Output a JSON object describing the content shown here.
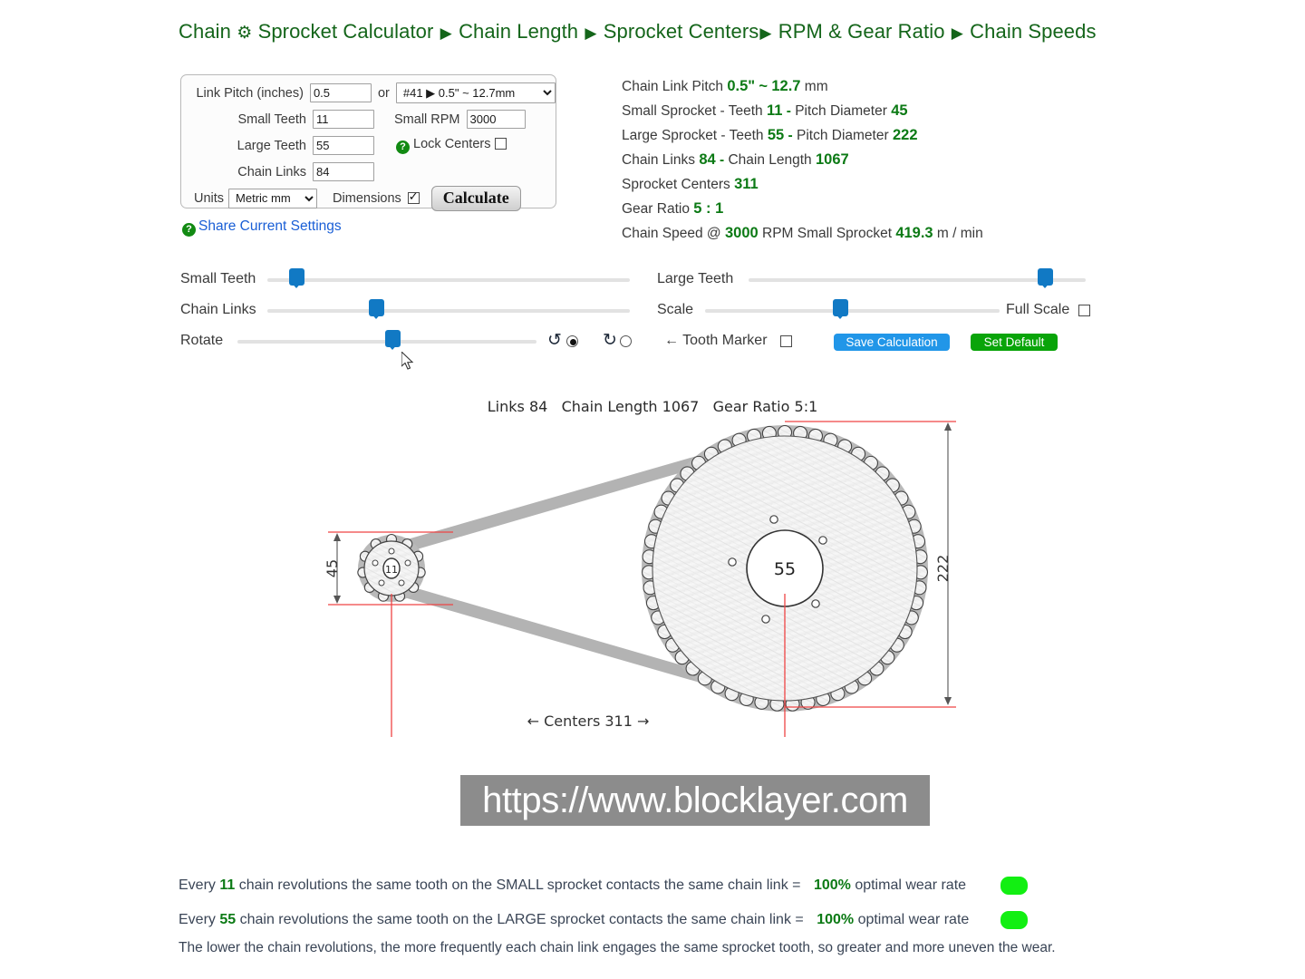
{
  "title": {
    "part1": "Chain",
    "gear_icon": "⚙",
    "part2": "Sprocket Calculator",
    "arrow": "▶",
    "link_chain_length": "Chain Length",
    "link_sprocket_centers": "Sprocket Centers",
    "link_rpm_gear_ratio": "RPM & Gear Ratio",
    "link_chain_speeds": "Chain Speeds"
  },
  "form": {
    "link_pitch_label": "Link Pitch (inches)",
    "link_pitch_value": "0.5",
    "or_label": "or",
    "chain_select_value": "#41 ▶ 0.5\" ~ 12.7mm",
    "small_teeth_label": "Small Teeth",
    "small_teeth_value": "11",
    "small_rpm_label": "Small RPM",
    "small_rpm_value": "3000",
    "large_teeth_label": "Large Teeth",
    "large_teeth_value": "55",
    "lock_centers_label": "Lock Centers",
    "chain_links_label": "Chain Links",
    "chain_links_value": "84",
    "units_label": "Units",
    "units_value": "Metric mm",
    "dimensions_label": "Dimensions",
    "calculate_label": "Calculate",
    "share_label": "Share Current Settings"
  },
  "results": {
    "pitch_prefix": "Chain Link Pitch",
    "pitch_inches": "0.5\"",
    "tilde": "~",
    "pitch_mm": "12.7",
    "pitch_unit": "mm",
    "small_prefix": "Small Sprocket - Teeth",
    "small_teeth": "11",
    "dash": "-",
    "small_pd_label": "Pitch Diameter",
    "small_pd": "45",
    "large_prefix": "Large Sprocket - Teeth",
    "large_teeth": "55",
    "large_pd_label": "Pitch Diameter",
    "large_pd": "222",
    "links_label": "Chain Links",
    "links": "84",
    "chain_length_label": "Chain Length",
    "chain_length": "1067",
    "centers_label": "Sprocket Centers",
    "centers": "311",
    "gear_ratio_label": "Gear Ratio",
    "gear_ratio": "5 : 1",
    "speed_prefix": "Chain Speed @",
    "speed_rpm": "3000",
    "speed_mid": "RPM Small Sprocket",
    "speed_value": "419.3",
    "speed_unit": "m / min"
  },
  "controls": {
    "small_teeth_label": "Small Teeth",
    "chain_links_label": "Chain Links",
    "rotate_label": "Rotate",
    "large_teeth_label": "Large Teeth",
    "scale_label": "Scale",
    "full_scale_label": "Full Scale",
    "tooth_marker_label": "← Tooth Marker",
    "save_label": "Save Calculation",
    "default_label": "Set Default",
    "ccw_icon": "↺",
    "cw_icon": "↻",
    "small_teeth_pct": 8,
    "chain_links_pct": 30,
    "rotate_pct": 52,
    "large_teeth_pct": 88,
    "scale_pct": 46
  },
  "diagram": {
    "header_links_label": "Links",
    "header_links": "84",
    "header_length_label": "Chain Length",
    "header_length": "1067",
    "header_ratio_label": "Gear Ratio",
    "header_ratio": "5:1",
    "small_hub_text": "11",
    "large_hub_text": "55",
    "small_dim": "45",
    "large_dim": "222",
    "centers_dim": "← Centers 311 →",
    "small_teeth_count": 11,
    "large_teeth_count": 55
  },
  "watermark": {
    "url": "https://www.blocklayer.com"
  },
  "footer": {
    "line1_a": "Every",
    "line1_num": "11",
    "line1_b": "chain revolutions the same tooth on the SMALL sprocket contacts the same chain link =",
    "line1_pct": "100%",
    "line1_c": "optimal wear rate",
    "line2_a": "Every",
    "line2_num": "55",
    "line2_b": "chain revolutions the same tooth on the LARGE sprocket contacts the same chain link =",
    "line2_pct": "100%",
    "line2_c": "optimal wear rate",
    "note": "The lower the chain revolutions, the more frequently each chain link engages the same sprocket tooth, so greater and more uneven the wear."
  },
  "colors": {
    "green": "#0c7a15",
    "link_blue": "#1a5fd6",
    "slider_blue": "#1179c4",
    "save_blue": "#2196e8",
    "default_green": "#09a409",
    "dim_red": "#ef4444",
    "wear_dot": "#12ef12"
  }
}
